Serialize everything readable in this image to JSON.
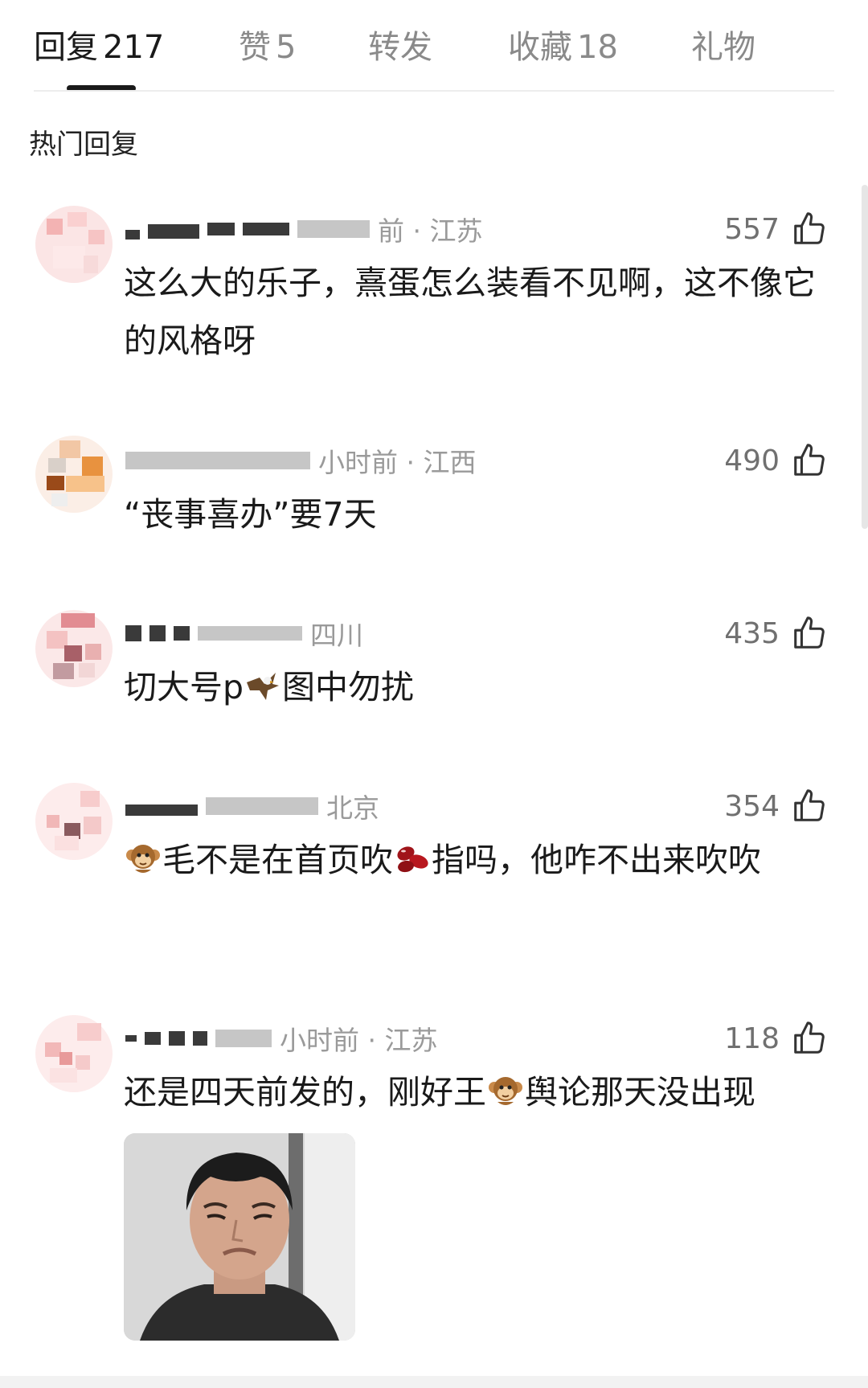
{
  "tabs": [
    {
      "label": "回复",
      "count": "217",
      "active": true
    },
    {
      "label": "赞",
      "count": "5",
      "active": false
    },
    {
      "label": "转发",
      "count": "",
      "active": false
    },
    {
      "label": "收藏",
      "count": "18",
      "active": false
    },
    {
      "label": "礼物",
      "count": "",
      "active": false
    }
  ],
  "section_title": "热门回复",
  "comments": [
    {
      "meta_visible": "前 · 江苏",
      "likes": "557",
      "text": "这么大的乐子，熹蛋怎么装看不见啊，这不像它的风格呀"
    },
    {
      "meta_visible": "小时前 · 江西",
      "likes": "490",
      "text": "“丧事喜办”要7天"
    },
    {
      "meta_visible": "四川",
      "likes": "435",
      "text_parts": [
        "切大号p",
        "图中勿扰"
      ],
      "emoji": "eagle-icon"
    },
    {
      "meta_visible": "北京",
      "likes": "354",
      "text_parts": [
        "毛不是在首页吹",
        "指吗，他咋不出来吹吹"
      ],
      "emojis": [
        "monkey-icon",
        "beans-icon"
      ]
    },
    {
      "meta_visible": "小时前 · 江苏",
      "likes": "118",
      "text_parts": [
        "还是四天前发的，刚好王",
        "舆论那天没出现"
      ],
      "emoji": "monkey-icon"
    }
  ],
  "colors": {
    "active_tab": "#1a1a1a",
    "inactive_tab": "#8a8a8a",
    "meta": "#9a9a9a",
    "divider": "#ededed"
  },
  "icons": [
    "thumbs-up-icon",
    "monkey-icon",
    "eagle-icon",
    "beans-icon"
  ]
}
